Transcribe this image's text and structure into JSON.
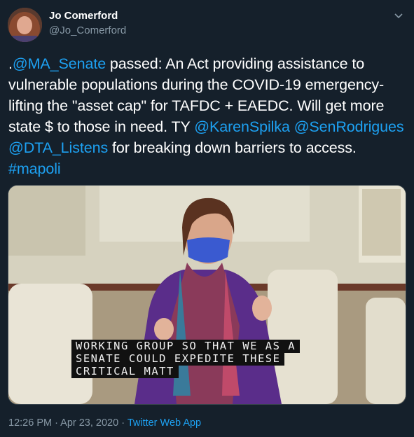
{
  "author": {
    "name": "Jo Comerford",
    "handle": "@Jo_Comerford"
  },
  "tweet": {
    "p1": ".",
    "m1": "@MA_Senate",
    "p2": " passed: An Act providing assistance to vulnerable populations during the COVID-19 emergency- lifting the \"asset cap\" for TAFDC + EAEDC. Will get more state $ to those in need. TY ",
    "m2": "@KarenSpilka",
    "p3": " ",
    "m3": "@SenRodrigues",
    "p4": " ",
    "m4": "@DTA_Listens",
    "p5": " for breaking down barriers to access. ",
    "h1": "#mapoli"
  },
  "media": {
    "caption_lines": [
      "WORKING GROUP SO THAT WE AS A",
      "SENATE COULD EXPEDITE THESE",
      "CRITICAL MATT"
    ]
  },
  "meta": {
    "timestamp": "12:26 PM · Apr 23, 2020 · ",
    "app": "Twitter Web App"
  },
  "icons": {
    "menu": "chevron-down-icon"
  },
  "colors": {
    "background": "#15202b",
    "link": "#1da1f2",
    "secondary_text": "#8899a6"
  }
}
